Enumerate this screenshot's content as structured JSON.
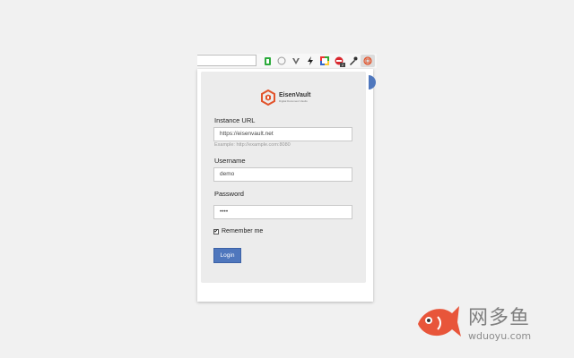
{
  "toolbar": {
    "extensions": [
      {
        "icon": "evernote-green-icon"
      },
      {
        "icon": "circle-outline-icon"
      },
      {
        "icon": "vivaldi-v-icon"
      },
      {
        "icon": "lightning-bolt-icon"
      },
      {
        "icon": "color-picker-icon"
      },
      {
        "icon": "adblock-red-icon",
        "badge": "2"
      },
      {
        "icon": "eyedropper-icon"
      },
      {
        "icon": "eisenvault-extension-icon",
        "active": true
      }
    ]
  },
  "popup": {
    "logo": {
      "name": "EisenVault",
      "tagline": "Digital Document Vaults"
    },
    "instance_url": {
      "label": "Instance URL",
      "value": "https://eisenvault.net",
      "hint": "Example: http://example.com:8080"
    },
    "username": {
      "label": "Username",
      "value": "demo"
    },
    "password": {
      "label": "Password",
      "value": "••••"
    },
    "remember": {
      "label": "Remember me",
      "checked": true,
      "mark": "✔"
    },
    "login_label": "Login"
  },
  "watermark": {
    "title": "网多鱼",
    "url": "wduoyu.com"
  },
  "colors": {
    "accent": "#4f77bd",
    "logo_orange": "#e2532b"
  }
}
